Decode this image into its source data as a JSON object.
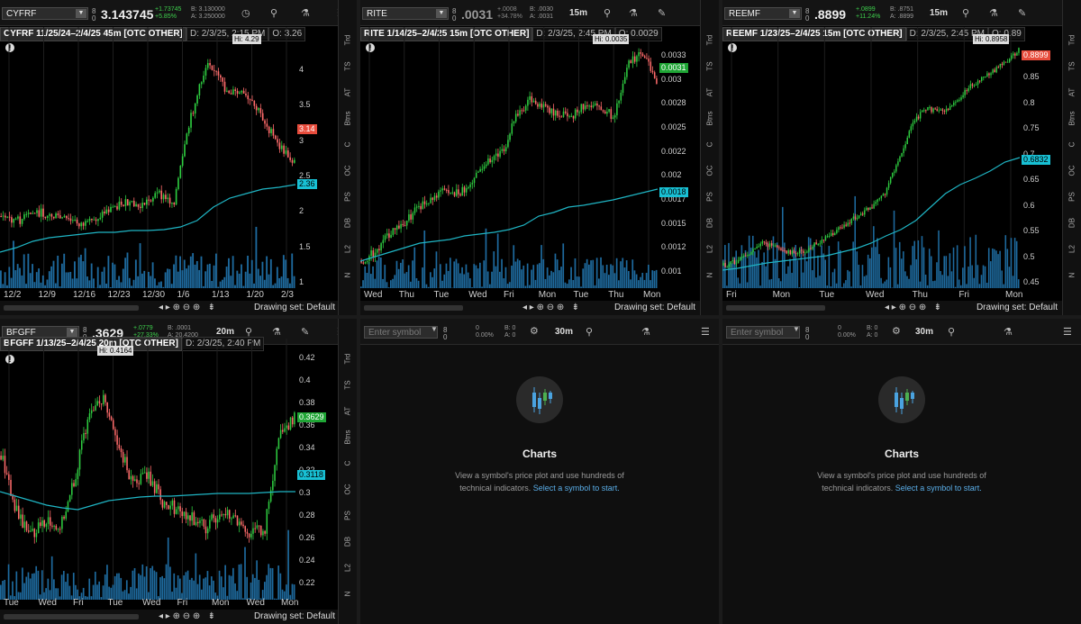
{
  "panels": [
    {
      "symbol": "CYFRF",
      "qty": "0",
      "last": "3.143745",
      "chg": "+1.73745",
      "chg_pct": "+5.85%",
      "bid": "B: 3.130000",
      "ask": "A: 3.250000",
      "agg": "",
      "header_title": "CYFRF 11/25/24–2/4/25 45m [OTC OTHER]",
      "header_date": "D: 2/3/25, 2:15 PM",
      "header_o": "O: 3.26",
      "y_ticks": [
        "4",
        "3.5",
        "3",
        "2.5",
        "2",
        "1.5",
        "1"
      ],
      "x_labels": [
        "12/2",
        "12/9",
        "12/16",
        "12/23",
        "12/30",
        "1/6",
        "1/13",
        "1/20",
        "2/3"
      ],
      "price_tag": "3.14",
      "ma_tag": "2.36",
      "hi_label": "Hi: 4.29",
      "drawing_set": "Drawing set: Default"
    },
    {
      "symbol": "RITE",
      "qty": "0",
      "last": ".0031",
      "chg": "+.0008",
      "chg_pct": "+34.78%",
      "bid": "B: .0030",
      "ask": "A: .0031",
      "agg": "15m",
      "header_title": "RITE 1/14/25–2/4/25 15m [OTC OTHER]",
      "header_date": "D: 2/3/25, 2:45 PM",
      "header_o": "O: 0.0029",
      "y_ticks": [
        "0.0033",
        "0.003",
        "0.0028",
        "0.0025",
        "0.0022",
        "0.002",
        "0.0017",
        "0.0015",
        "0.0012",
        "0.001"
      ],
      "x_labels": [
        "Wed",
        "Thu",
        "Tue",
        "Wed",
        "Fri",
        "Mon",
        "Tue",
        "Thu",
        "Mon"
      ],
      "price_tag": "0.0031",
      "ma_tag": "0.0018",
      "hi_label": "Hi: 0.0035",
      "drawing_set": "Drawing set: Default"
    },
    {
      "symbol": "REEMF",
      "qty": "0",
      "last": ".8899",
      "chg": "+.0899",
      "chg_pct": "+11.24%",
      "bid": "B: .8751",
      "ask": "A: .8899",
      "agg": "15m",
      "header_title": "REEMF 1/23/25–2/4/25 15m [OTC OTHER]",
      "header_date": "D: 2/3/25, 2:45 PM",
      "header_o": "O: 0.89",
      "y_ticks": [
        "0.85",
        "0.8",
        "0.75",
        "0.7",
        "0.65",
        "0.6",
        "0.55",
        "0.5",
        "0.45"
      ],
      "x_labels": [
        "Fri",
        "Mon",
        "Tue",
        "Wed",
        "Thu",
        "Fri",
        "Mon"
      ],
      "price_tag": "0.8899",
      "ma_tag": "0.6832",
      "hi_label": "Hi: 0.8958",
      "drawing_set": "Drawing set: Default"
    },
    {
      "symbol": "BFGFF",
      "qty": "0",
      "last": ".3629",
      "chg": "+.0779",
      "chg_pct": "+27.33%",
      "bid": "B: .0001",
      "ask": "A: 20.4200",
      "agg": "20m",
      "header_title": "BFGFF 1/13/25–2/4/25 20m [OTC OTHER]",
      "header_date": "D: 2/3/25, 2:40 PM",
      "header_o": "",
      "y_ticks": [
        "0.42",
        "0.4",
        "0.38",
        "0.36",
        "0.34",
        "0.32",
        "0.3",
        "0.28",
        "0.26",
        "0.24",
        "0.22"
      ],
      "x_labels": [
        "Tue",
        "Wed",
        "Fri",
        "Tue",
        "Wed",
        "Fri",
        "Mon",
        "Wed",
        "Mon"
      ],
      "price_tag": "0.3629",
      "ma_tag": "0.3118",
      "hi_label": "Hi: 0.4164",
      "drawing_set": "Drawing set: Default"
    }
  ],
  "empty_panels": [
    {
      "placeholder": "Enter symbol",
      "qty": "0",
      "pct": "0.00%",
      "bid": "B: 0",
      "ask": "A: 0",
      "agg": "30m",
      "title": "Charts",
      "desc": "View a symbol's price plot and use hundreds of",
      "desc2": "technical indicators.",
      "link": "Select a symbol to start."
    },
    {
      "placeholder": "Enter symbol",
      "qty": "0",
      "pct": "0.00%",
      "bid": "B: 0",
      "ask": "A: 0",
      "agg": "30m",
      "title": "Charts",
      "desc": "View a symbol's price plot and use hundreds of",
      "desc2": "technical indicators.",
      "link": "Select a symbol to start."
    }
  ],
  "side_tabs": [
    "Trd",
    "TS",
    "AT",
    "Btns",
    "C",
    "OC",
    "PS",
    "DB",
    "L2",
    "N"
  ],
  "colors": {
    "up": "#2ecc40",
    "down": "#ff6b6b",
    "ma": "#1fb5c4",
    "volume": "#1e6a9e"
  }
}
